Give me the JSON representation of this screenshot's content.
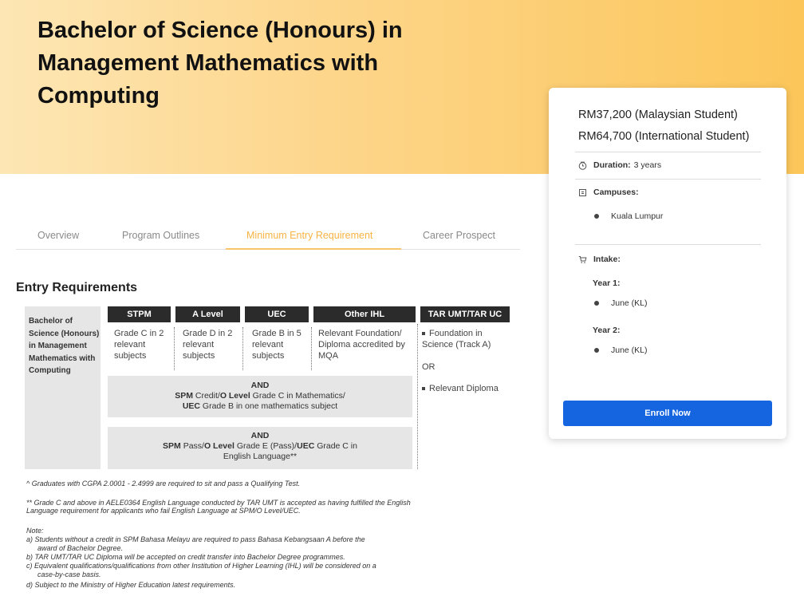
{
  "hero": {
    "title": "Bachelor of Science (Honours) in Management Mathematics with Computing"
  },
  "card": {
    "price_local": "RM37,200 (Malaysian Student)",
    "price_intl": "RM64,700 (International Student)",
    "duration_label": "Duration:",
    "duration_value": "3 years",
    "campuses_label": "Campuses:",
    "campus": "Kuala Lumpur",
    "intake_label": "Intake:",
    "year1_label": "Year 1:",
    "year1_value": "June (KL)",
    "year2_label": "Year 2:",
    "year2_value": "June (KL)",
    "enroll_label": "Enroll Now",
    "icons": [
      "clock-icon",
      "building-icon",
      "cart-icon"
    ]
  },
  "tabs": [
    {
      "label": "Overview"
    },
    {
      "label": "Program Outlines"
    },
    {
      "label": "Minimum Entry Requirement"
    },
    {
      "label": "Career Prospect"
    }
  ],
  "entry": {
    "title": "Entry Requirements",
    "program": "Bachelor of Science (Honours) in Management Mathematics with Computing",
    "headers": [
      "STPM",
      "A Level",
      "UEC",
      "Other IHL",
      "TAR UMT/TAR UC"
    ],
    "cells": [
      "Grade C in 2 relevant subjects",
      "Grade D in 2 relevant subjects",
      "Grade B in 5 relevant subjects",
      "Relevant Foundation/ Diploma accredited by MQA"
    ],
    "and1": {
      "and": "AND",
      "spm": "SPM",
      "spm_text": " Credit/",
      "olevel": "O Level",
      "olevel_text": " Grade C in Mathematics/",
      "uec": "UEC",
      "uec_text": " Grade B in one mathematics subject"
    },
    "and2": {
      "and": "AND",
      "spm": "SPM",
      "spm_text": " Pass/",
      "olevel": "O Level",
      "olevel_text": " Grade E (Pass)/",
      "uec": "UEC",
      "uec_text": " Grade C in",
      "line3": "English Language**"
    },
    "tar_item1": "Foundation in Science (Track A)",
    "tar_or": "OR",
    "tar_item2": "Relevant Diploma"
  },
  "notes": {
    "cgpa": "^ Graduates with CGPA 2.0001 - 2.4999 are required to sit and pass a Qualifying Test.",
    "english_1": "** Grade C and above in AELE0364 English Language conducted by TAR UMT is accepted as having fulfilled the English",
    "english_2": "Language requirement for applicants who fail English Language at SPM/O Level/UEC.",
    "note_label": "Note:",
    "a1": "a) Students without a credit in SPM Bahasa Melayu are required to pass Bahasa Kebangsaan A before the",
    "a2": "award of Bachelor Degree.",
    "b": "b) TAR UMT/TAR UC Diploma will be accepted on credit transfer into Bachelor Degree programmes.",
    "c1": "c) Equivalent qualifications/qualifications from other Institution of Higher Learning (IHL) will be considered on a",
    "c2": "case-by-case basis.",
    "d": "d) Subject to the Ministry of Higher Education latest requirements."
  }
}
